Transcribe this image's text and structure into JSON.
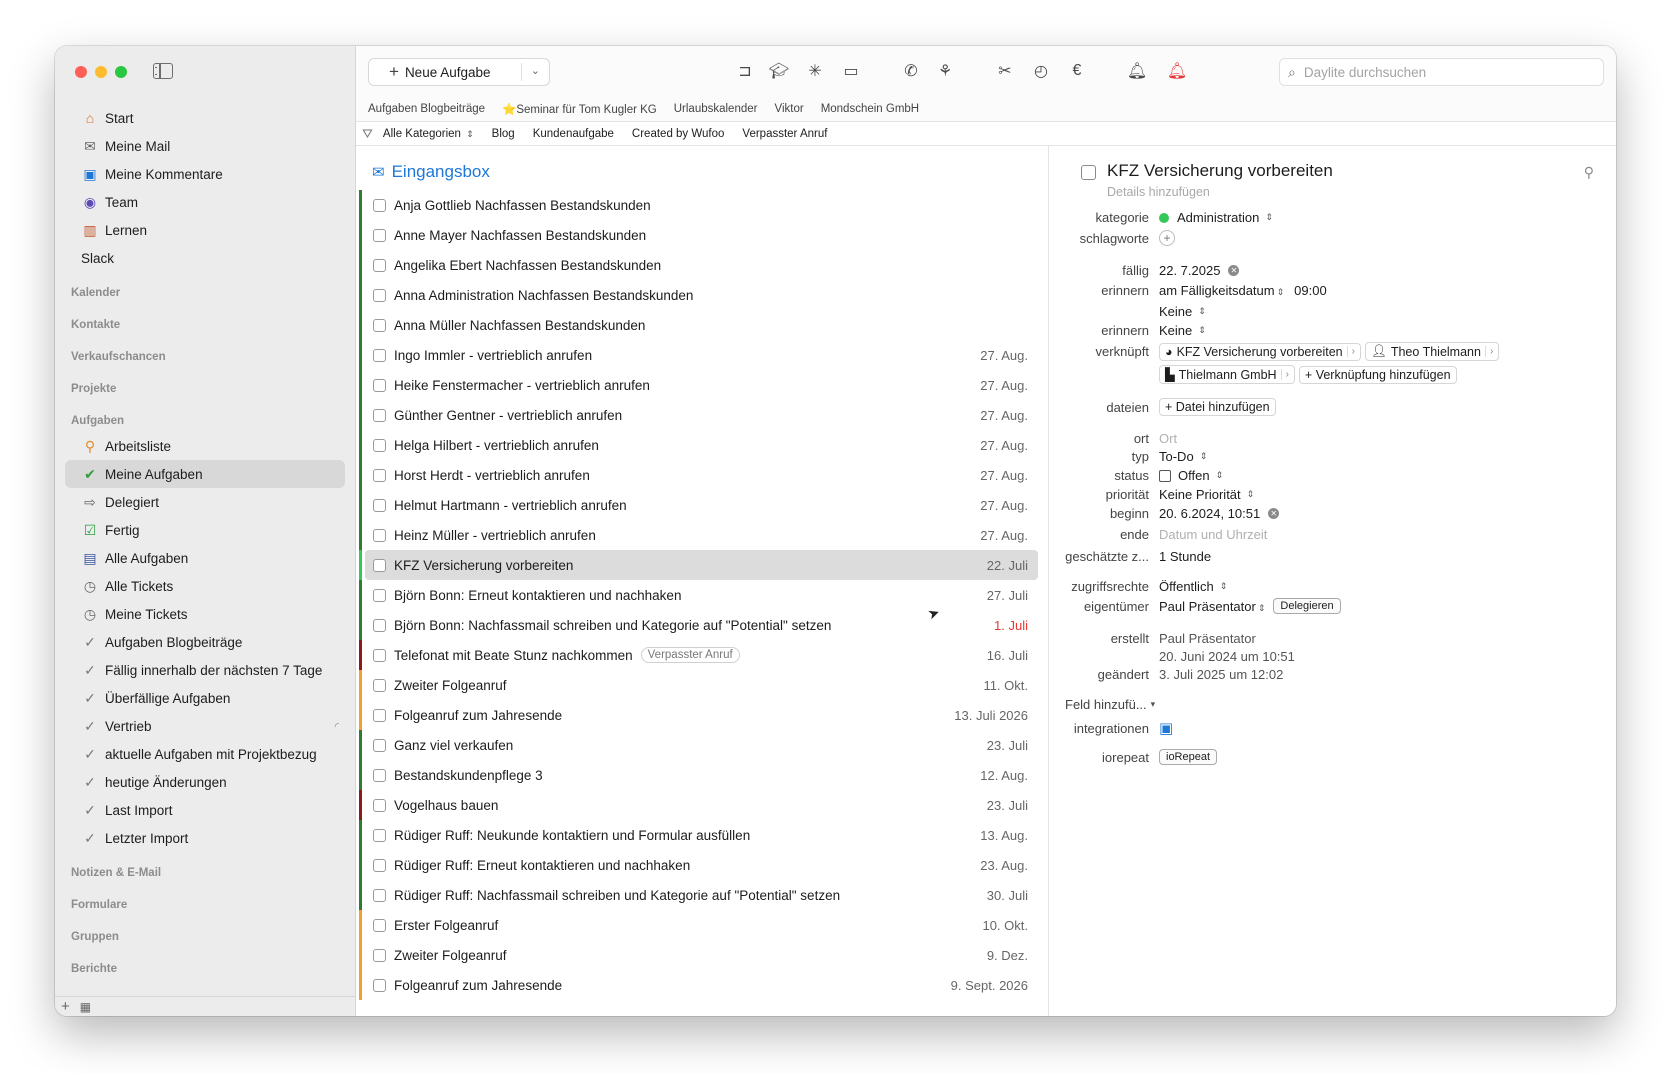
{
  "sidebar": {
    "top_items": [
      {
        "label": "Start",
        "icon": "house-icon"
      },
      {
        "label": "Meine Mail",
        "icon": "envelope-icon"
      },
      {
        "label": "Meine Kommentare",
        "icon": "speech-bubbles-icon"
      },
      {
        "label": "Team",
        "icon": "team-icon"
      },
      {
        "label": "Lernen",
        "icon": "books-icon"
      },
      {
        "label": "Slack",
        "icon": ""
      }
    ],
    "sections": [
      "Kalender",
      "Kontakte",
      "Verkaufschancen",
      "Projekte",
      "Aufgaben"
    ],
    "task_items": [
      {
        "label": "Arbeitsliste",
        "icon": "pin-icon"
      },
      {
        "label": "Meine Aufgaben",
        "icon": "checkmark-icon"
      },
      {
        "label": "Delegiert",
        "icon": "arrow-right-icon"
      },
      {
        "label": "Fertig",
        "icon": "checkbox-checked-icon"
      },
      {
        "label": "Alle Aufgaben",
        "icon": "tasklist-icon"
      },
      {
        "label": "Alle Tickets",
        "icon": "clock-icon"
      },
      {
        "label": "Meine Tickets",
        "icon": "clock-icon"
      },
      {
        "label": "Aufgaben Blogbeiträge",
        "icon": "smart-filter-icon"
      },
      {
        "label": "Fällig innerhalb der nächsten 7 Tage",
        "icon": "smart-filter-icon"
      },
      {
        "label": "Überfällige Aufgaben",
        "icon": "smart-filter-icon"
      },
      {
        "label": "Vertrieb",
        "icon": "smart-filter-icon"
      },
      {
        "label": "aktuelle Aufgaben mit Projektbezug",
        "icon": "smart-filter-icon"
      },
      {
        "label": "heutige Änderungen",
        "icon": "smart-filter-icon"
      },
      {
        "label": "Last Import",
        "icon": "smart-filter-icon"
      },
      {
        "label": "Letzter Import",
        "icon": "smart-filter-icon"
      }
    ],
    "bottom_sections": [
      "Notizen & E-Mail",
      "Formulare",
      "Gruppen",
      "Berichte"
    ]
  },
  "toolbar": {
    "new_task_label": "Neue Aufgabe",
    "search_placeholder": "Daylite durchsuchen"
  },
  "tabs": [
    "Aufgaben Blogbeiträge",
    "⭐Seminar für Tom Kugler KG",
    "Urlaubskalender",
    "Viktor",
    "Mondschein GmbH"
  ],
  "filters": {
    "selected": "Alle Kategorien",
    "items": [
      "Blog",
      "Kundenaufgabe",
      "Created by Wufoo",
      "Verpasster Anruf"
    ]
  },
  "list": {
    "header": "Eingangsbox",
    "rows": [
      {
        "title": "Anja Gottlieb Nachfassen Bestandskunden",
        "date": "",
        "color": "#2e7d32"
      },
      {
        "title": "Anne Mayer Nachfassen Bestandskunden",
        "date": "",
        "color": "#2e7d32"
      },
      {
        "title": "Angelika Ebert Nachfassen Bestandskunden",
        "date": "",
        "color": "#2e7d32"
      },
      {
        "title": "Anna Administration Nachfassen Bestandskunden",
        "date": "",
        "color": "#2e7d32"
      },
      {
        "title": "Anna Müller Nachfassen Bestandskunden",
        "date": "",
        "color": "#2e7d32"
      },
      {
        "title": "Ingo Immler - vertrieblich anrufen",
        "date": "27. Aug.",
        "color": "#2e7d32"
      },
      {
        "title": "Heike Fenstermacher - vertrieblich anrufen",
        "date": "27. Aug.",
        "color": "#2e7d32"
      },
      {
        "title": "Günther Gentner - vertrieblich anrufen",
        "date": "27. Aug.",
        "color": "#2e7d32"
      },
      {
        "title": "Helga Hilbert - vertrieblich anrufen",
        "date": "27. Aug.",
        "color": "#2e7d32"
      },
      {
        "title": "Horst Herdt - vertrieblich anrufen",
        "date": "27. Aug.",
        "color": "#2e7d32"
      },
      {
        "title": "Helmut Hartmann - vertrieblich anrufen",
        "date": "27. Aug.",
        "color": "#2e7d32"
      },
      {
        "title": "Heinz Müller - vertrieblich anrufen",
        "date": "27. Aug.",
        "color": "#2e7d32"
      },
      {
        "title": "KFZ Versicherung vorbereiten",
        "date": "22. Juli",
        "color": "#34c759",
        "selected": true
      },
      {
        "title": "Björn Bonn: Erneut kontaktieren und nachhaken",
        "date": "27. Juli",
        "color": "#2e7d32"
      },
      {
        "title": "Björn Bonn: Nachfassmail schreiben und Kategorie auf \"Potential\" setzen",
        "date": "1. Juli",
        "color": "#2e7d32",
        "overdue": true
      },
      {
        "title": "Telefonat mit Beate Stunz nachkommen",
        "date": "16. Juli",
        "color": "#8b1a1a",
        "tag": "Verpasster Anruf"
      },
      {
        "title": "Zweiter Folgeanruf",
        "date": "11. Okt.",
        "color": "#f0a030"
      },
      {
        "title": "Folgeanruf zum Jahresende",
        "date": "13. Juli 2026",
        "color": "#f0a030"
      },
      {
        "title": "Ganz viel verkaufen",
        "date": "23. Juli",
        "color": "#2e7d32"
      },
      {
        "title": "Bestandskundenpflege 3",
        "date": "12. Aug.",
        "color": "#2e7d32"
      },
      {
        "title": "Vogelhaus bauen",
        "date": "23. Juli",
        "color": "#8b1a1a"
      },
      {
        "title": "Rüdiger Ruff: Neukunde kontaktiern und Formular ausfüllen",
        "date": "13. Aug.",
        "color": "#2e7d32"
      },
      {
        "title": "Rüdiger Ruff: Erneut kontaktieren und nachhaken",
        "date": "23. Aug.",
        "color": "#2e7d32"
      },
      {
        "title": "Rüdiger Ruff: Nachfassmail schreiben und Kategorie auf \"Potential\" setzen",
        "date": "30. Juli",
        "color": "#2e7d32"
      },
      {
        "title": "Erster Folgeanruf",
        "date": "10. Okt.",
        "color": "#f0a030"
      },
      {
        "title": "Zweiter Folgeanruf",
        "date": "9. Dez.",
        "color": "#f0a030"
      },
      {
        "title": "Folgeanruf zum Jahresende",
        "date": "9. Sept. 2026",
        "color": "#f0a030"
      }
    ]
  },
  "detail": {
    "title": "KFZ Versicherung vorbereiten",
    "details_placeholder": "Details hinzufügen",
    "labels": {
      "kategorie": "kategorie",
      "schlagworte": "schlagworte",
      "faellig": "fällig",
      "erinnern": "erinnern",
      "verknuepft": "verknüpft",
      "dateien": "dateien",
      "ort": "ort",
      "typ": "typ",
      "status": "status",
      "prioritaet": "priorität",
      "beginn": "beginn",
      "ende": "ende",
      "geschaetzt": "geschätzte z...",
      "zugriffsrechte": "zugriffsrechte",
      "eigentuemer": "eigentümer",
      "erstellt": "erstellt",
      "geaendert": "geändert",
      "feld": "Feld hinzufü...",
      "integrationen": "integrationen",
      "iorepeat": "iorepeat"
    },
    "kategorie": "Administration",
    "faellig": "22. 7.2025",
    "erinnern_1": "am Fälligkeitsdatum",
    "erinnern_time": "09:00",
    "erinnern_sub": "Keine",
    "erinnern_2": "Keine",
    "links": [
      "KFZ Versicherung vorbereiten",
      "Theo Thielmann",
      "Thielmann GmbH"
    ],
    "add_link": "+ Verknüpfung hinzufügen",
    "add_file": "+ Datei hinzufügen",
    "ort_placeholder": "Ort",
    "typ": "To-Do",
    "status": "Offen",
    "prioritaet": "Keine Priorität",
    "beginn": "20. 6.2024, 10:51",
    "ende_placeholder": "Datum und Uhrzeit",
    "geschaetzt": "1 Stunde",
    "zugriffsrechte": "Öffentlich",
    "eigentuemer": "Paul Präsentator",
    "delegieren": "Delegieren",
    "erstellt_by": "Paul Präsentator",
    "erstellt_date": "20. Juni 2024 um 10:51",
    "geaendert": "3. Juli 2025 um 12:02",
    "iorepeat_btn": "ioRepeat"
  },
  "colors": {
    "accent": "#1e78d6",
    "overdue": "#e53935",
    "category_green": "#34c759"
  }
}
